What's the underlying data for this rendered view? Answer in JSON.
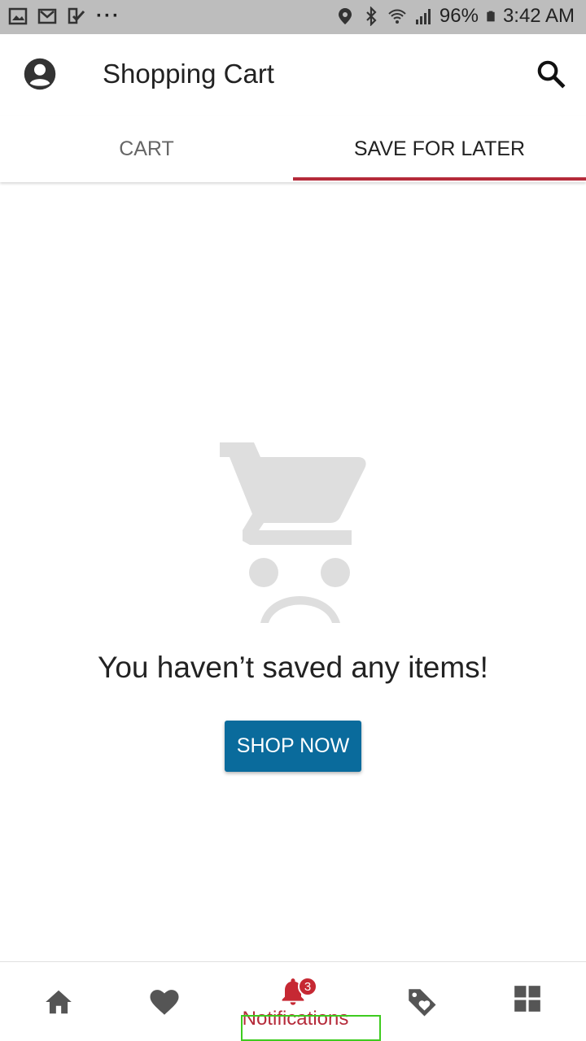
{
  "status_bar": {
    "battery": "96%",
    "time": "3:42 AM",
    "icons": [
      "gallery-icon",
      "gmail-icon",
      "checklist-icon",
      "more-dots-icon",
      "location-icon",
      "bluetooth-icon",
      "wifi-icon",
      "signal-icon",
      "battery-icon"
    ]
  },
  "app_bar": {
    "title": "Shopping Cart",
    "account_icon": "account-circle-icon",
    "search_icon": "search-icon"
  },
  "tabs": [
    {
      "label": "CART",
      "selected": false
    },
    {
      "label": "SAVE FOR LATER",
      "selected": true
    }
  ],
  "empty_state": {
    "icon": "sad-cart-icon",
    "message": "You haven’t saved any items!",
    "button_label": "SHOP NOW"
  },
  "bottom_nav": {
    "items": [
      {
        "icon": "home-icon"
      },
      {
        "icon": "heart-icon"
      },
      {
        "icon": "bell-icon",
        "label": "Notifications",
        "badge": "3",
        "selected": true
      },
      {
        "icon": "tag-heart-icon"
      },
      {
        "icon": "grid-icon"
      }
    ]
  },
  "colors": {
    "accent": "#b52b3a",
    "button": "#0a6b9c",
    "status_bar": "#bdbdbd",
    "icon_gray": "#555555"
  }
}
